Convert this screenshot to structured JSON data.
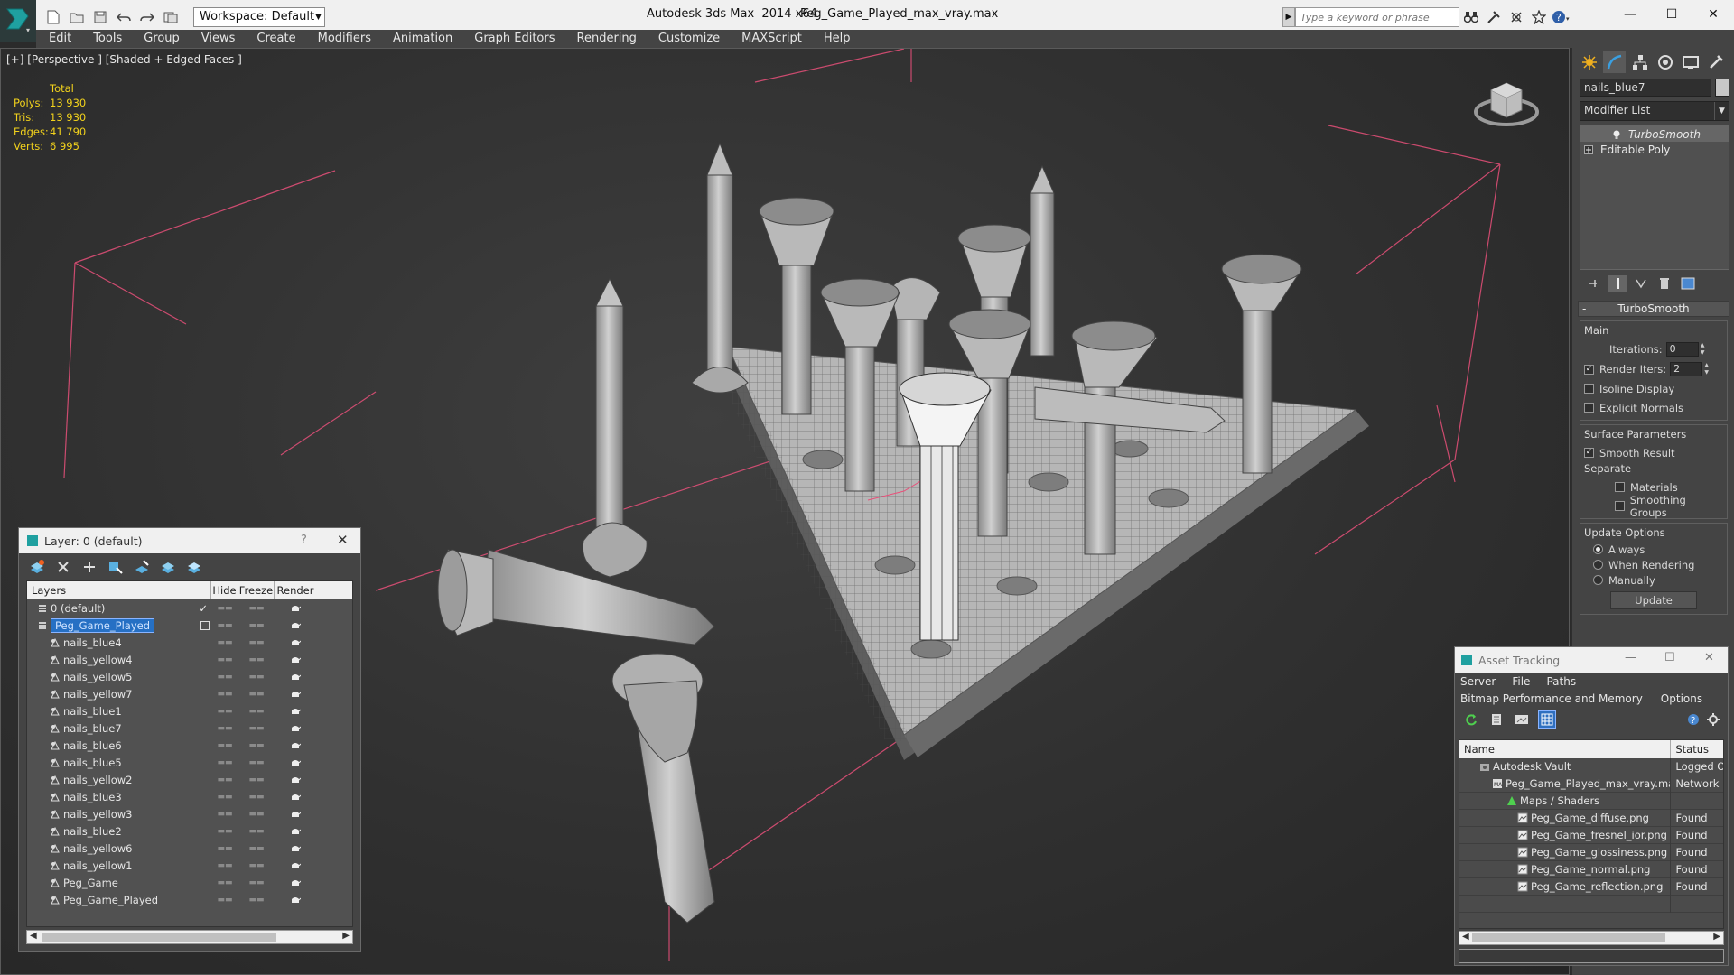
{
  "titlebar": {
    "workspace": "Workspace: Default",
    "app_title": "Autodesk 3ds Max  2014 x64",
    "file_title": "Peg_Game_Played_max_vray.max",
    "search_placeholder": "Type a keyword or phrase",
    "minimize": "—",
    "maximize": "☐",
    "close": "✕"
  },
  "menu": [
    "Edit",
    "Tools",
    "Group",
    "Views",
    "Create",
    "Modifiers",
    "Animation",
    "Graph Editors",
    "Rendering",
    "Customize",
    "MAXScript",
    "Help"
  ],
  "viewport": {
    "label": "[+] [Perspective ] [Shaded + Edged Faces ]",
    "stats": {
      "header": "Total",
      "rows": [
        {
          "label": "Polys:",
          "value": "13 930"
        },
        {
          "label": "Tris:",
          "value": "13 930"
        },
        {
          "label": "Edges:",
          "value": "41 790"
        },
        {
          "label": "Verts:",
          "value": "6 995"
        }
      ]
    }
  },
  "command_panel": {
    "object_name": "nails_blue7",
    "modifier_list": "Modifier List",
    "stack": [
      "TurboSmooth",
      "Editable Poly"
    ],
    "rollout": {
      "title": "TurboSmooth",
      "main_label": "Main",
      "iterations_label": "Iterations:",
      "iterations_value": "0",
      "render_iters_label": "Render Iters:",
      "render_iters_value": "2",
      "isoline_label": "Isoline Display",
      "explicit_normals_label": "Explicit Normals",
      "surface_params_label": "Surface Parameters",
      "smooth_result_label": "Smooth Result",
      "separate_label": "Separate",
      "materials_label": "Materials",
      "smoothing_groups_label": "Smoothing Groups",
      "update_options_label": "Update Options",
      "always_label": "Always",
      "when_rendering_label": "When Rendering",
      "manually_label": "Manually",
      "update_button": "Update"
    }
  },
  "layer_panel": {
    "title": "Layer: 0 (default)",
    "help": "?",
    "close": "✕",
    "columns": {
      "layers": "Layers",
      "hide": "Hide",
      "freeze": "Freeze",
      "render": "Render"
    },
    "rows": [
      {
        "name": "0 (default)",
        "level": 1,
        "kind": "layer"
      },
      {
        "name": "Peg_Game_Played",
        "level": 1,
        "kind": "layer"
      },
      {
        "name": "nails_blue4",
        "level": 2,
        "kind": "object"
      },
      {
        "name": "nails_yellow4",
        "level": 2,
        "kind": "object"
      },
      {
        "name": "nails_yellow5",
        "level": 2,
        "kind": "object"
      },
      {
        "name": "nails_yellow7",
        "level": 2,
        "kind": "object"
      },
      {
        "name": "nails_blue1",
        "level": 2,
        "kind": "object"
      },
      {
        "name": "nails_blue7",
        "level": 2,
        "kind": "object"
      },
      {
        "name": "nails_blue6",
        "level": 2,
        "kind": "object"
      },
      {
        "name": "nails_blue5",
        "level": 2,
        "kind": "object"
      },
      {
        "name": "nails_yellow2",
        "level": 2,
        "kind": "object"
      },
      {
        "name": "nails_blue3",
        "level": 2,
        "kind": "object"
      },
      {
        "name": "nails_yellow3",
        "level": 2,
        "kind": "object"
      },
      {
        "name": "nails_blue2",
        "level": 2,
        "kind": "object"
      },
      {
        "name": "nails_yellow6",
        "level": 2,
        "kind": "object"
      },
      {
        "name": "nails_yellow1",
        "level": 2,
        "kind": "object"
      },
      {
        "name": "Peg_Game",
        "level": 2,
        "kind": "object"
      },
      {
        "name": "Peg_Game_Played",
        "level": 2,
        "kind": "object"
      }
    ]
  },
  "asset_panel": {
    "title": "Asset Tracking",
    "menu_row1": [
      "Server",
      "File",
      "Paths"
    ],
    "menu_row2": [
      "Bitmap Performance and Memory",
      "Options"
    ],
    "columns": {
      "name": "Name",
      "status": "Status"
    },
    "rows": [
      {
        "name": "Autodesk Vault",
        "status": "Logged Out",
        "level": 1,
        "icon": "vault"
      },
      {
        "name": "Peg_Game_Played_max_vray.max",
        "status": "Network Path",
        "level": 2,
        "icon": "max-file"
      },
      {
        "name": "Maps / Shaders",
        "status": "",
        "level": 3,
        "icon": "maps"
      },
      {
        "name": "Peg_Game_diffuse.png",
        "status": "Found",
        "level": 4,
        "icon": "bitmap"
      },
      {
        "name": "Peg_Game_fresnel_ior.png",
        "status": "Found",
        "level": 4,
        "icon": "bitmap"
      },
      {
        "name": "Peg_Game_glossiness.png",
        "status": "Found",
        "level": 4,
        "icon": "bitmap"
      },
      {
        "name": "Peg_Game_normal.png",
        "status": "Found",
        "level": 4,
        "icon": "bitmap"
      },
      {
        "name": "Peg_Game_reflection.png",
        "status": "Found",
        "level": 4,
        "icon": "bitmap"
      }
    ]
  },
  "colors": {
    "stats_text": "#f2d21c",
    "selection": "#2670c4",
    "viewport_bg": "#333333",
    "grid_lines": "#e8507a"
  }
}
